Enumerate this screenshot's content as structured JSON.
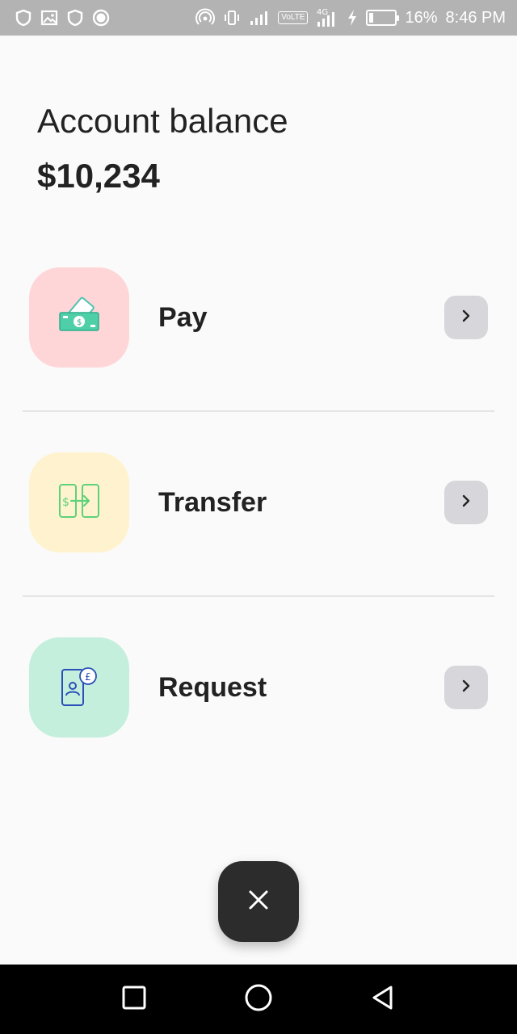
{
  "status_bar": {
    "battery_percent": "16%",
    "time": "8:46 PM",
    "network_label": "VoLTE",
    "network_gen": "4G",
    "battery_level": 0.16,
    "left_icons": [
      "shield-icon",
      "image-icon",
      "shield-icon",
      "record-icon"
    ],
    "right_icons": [
      "hotspot-icon",
      "vibrate-icon",
      "signal-icon",
      "volte-icon",
      "signal-4g-icon",
      "charging-icon",
      "battery-icon"
    ]
  },
  "balance": {
    "label": "Account balance",
    "value": "$10,234"
  },
  "actions": [
    {
      "label": "Pay",
      "icon": "money-icon",
      "tile_color": "#ffd6d8"
    },
    {
      "label": "Transfer",
      "icon": "phone-transfer-icon",
      "tile_color": "#fff3cf"
    },
    {
      "label": "Request",
      "icon": "phone-request-icon",
      "tile_color": "#c5efdd"
    }
  ],
  "fab": {
    "icon": "close-icon"
  },
  "nav_bar": {
    "icons": [
      "recents-icon",
      "home-icon",
      "back-icon"
    ]
  }
}
